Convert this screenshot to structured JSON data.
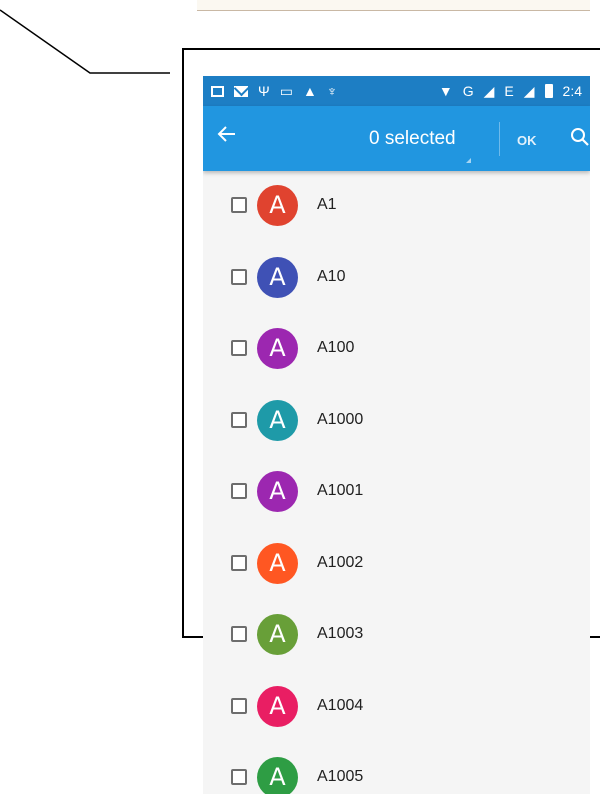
{
  "status_bar": {
    "left_icons": [
      "image-icon",
      "mail-icon",
      "usb-icon",
      "battery-charge-icon",
      "warning-icon",
      "android-icon"
    ],
    "network": "G",
    "network2": "E",
    "time": "2:4"
  },
  "toolbar": {
    "title": "0 selected",
    "ok_label": "OK"
  },
  "contacts": [
    {
      "initial": "A",
      "name": "A1",
      "color": "#e0432f"
    },
    {
      "initial": "A",
      "name": "A10",
      "color": "#3f51b5"
    },
    {
      "initial": "A",
      "name": "A100",
      "color": "#9c27b0"
    },
    {
      "initial": "A",
      "name": "A1000",
      "color": "#1e9aa8"
    },
    {
      "initial": "A",
      "name": "A1001",
      "color": "#9c27b0"
    },
    {
      "initial": "A",
      "name": "A1002",
      "color": "#ff5722"
    },
    {
      "initial": "A",
      "name": "A1003",
      "color": "#689f38"
    },
    {
      "initial": "A",
      "name": "A1004",
      "color": "#e91e63"
    },
    {
      "initial": "A",
      "name": "A1005",
      "color": "#2e9d44"
    }
  ],
  "colors": {
    "status_bar": "#1d7ec4",
    "toolbar": "#2196e0",
    "list_bg": "#f5f5f5"
  }
}
